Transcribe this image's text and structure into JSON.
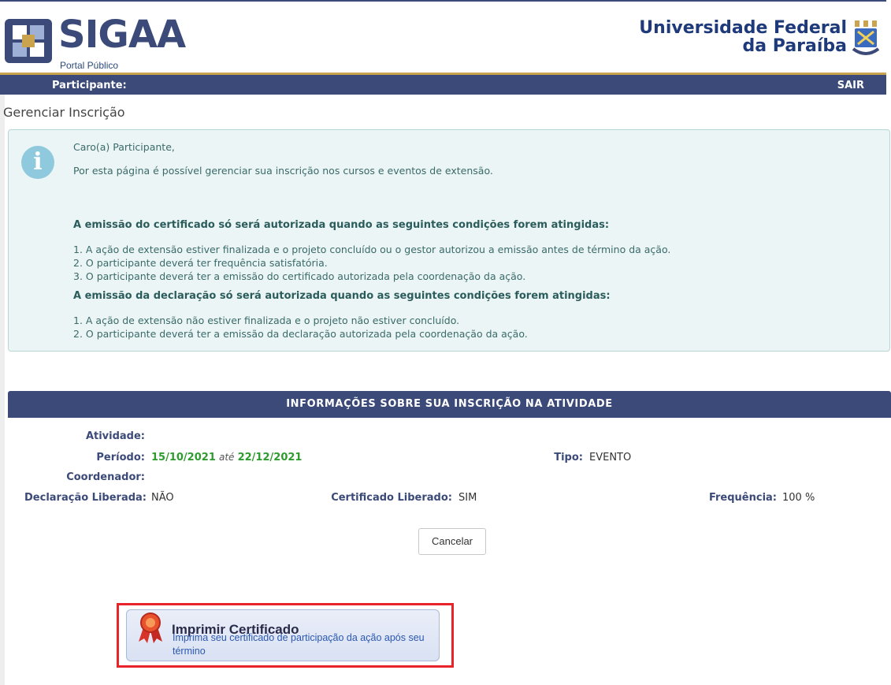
{
  "header": {
    "logo_text": "SIGAA",
    "logo_sub": "Portal Público",
    "university_line1": "Universidade Federal",
    "university_line2": "da Paraíba"
  },
  "bar": {
    "participant_label": "Participante:",
    "exit_label": "SAIR"
  },
  "page_title": "Gerenciar Inscrição",
  "info": {
    "greeting": "Caro(a) Participante,",
    "intro": "Por esta página é possível gerenciar sua inscrição nos cursos e eventos de extensão.",
    "cert_heading": "A emissão do certificado só será autorizada quando as seguintes condições forem atingidas:",
    "cert_conditions": [
      "1. A ação de extensão estiver finalizada e o projeto concluído ou o gestor autorizou a emissão antes de término da ação.",
      "2. O participante deverá ter frequência satisfatória.",
      "3. O participante deverá ter a emissão do certificado autorizada pela coordenação da ação."
    ],
    "decl_heading": "A emissão da declaração só será autorizada quando as seguintes condições forem atingidas:",
    "decl_conditions": [
      "1. A ação de extensão não estiver finalizada e o projeto não estiver concluído.",
      "2. O participante deverá ter a emissão da declaração autorizada pela coordenação da ação."
    ]
  },
  "details": {
    "header": "INFORMAÇÕES SOBRE SUA INSCRIÇÃO NA ATIVIDADE",
    "activity_label": "Atividade:",
    "period_label": "Período:",
    "period_start": "15/10/2021",
    "period_sep": "até",
    "period_end": "22/12/2021",
    "type_label": "Tipo:",
    "type_value": "EVENTO",
    "coordinator_label": "Coordenador:",
    "declaration_label": "Declaração Liberada:",
    "declaration_value": "NÃO",
    "certificate_label": "Certificado Liberado:",
    "certificate_value": "SIM",
    "frequency_label": "Frequência:",
    "frequency_value": "100 %",
    "cancel_button": "Cancelar"
  },
  "certificate": {
    "title": "Imprimir Certificado",
    "description": "Imprima seu certificado de participação da ação após seu término"
  },
  "colors": {
    "navy": "#3b4a78",
    "gold": "#c9a34e",
    "highlight": "#e8232a",
    "green": "#2e9b2e"
  }
}
